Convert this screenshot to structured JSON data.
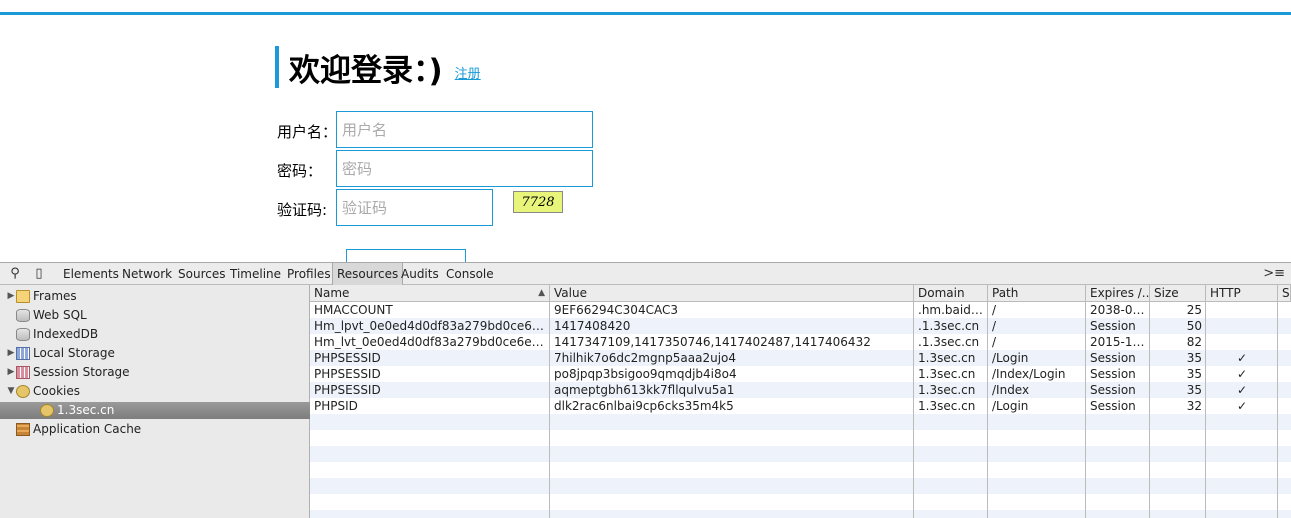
{
  "login": {
    "title": "欢迎登录：)",
    "register_link": "注册",
    "username": {
      "label": "用户名：",
      "placeholder": "用户名",
      "value": ""
    },
    "password": {
      "label": "密码：",
      "placeholder": "密码",
      "value": ""
    },
    "captcha": {
      "label": "验证码:",
      "placeholder": "验证码",
      "value": "",
      "image_text": "7728"
    }
  },
  "colors": {
    "accent": "#1a9ad6",
    "captcha_bg": "#e8f57a"
  },
  "devtools": {
    "icons": {
      "search": "search-icon",
      "device": "device-icon",
      "drawer": "drawer-toggle-icon"
    },
    "tabs": [
      {
        "label": "Elements"
      },
      {
        "label": "Network"
      },
      {
        "label": "Sources"
      },
      {
        "label": "Timeline"
      },
      {
        "label": "Profiles"
      },
      {
        "label": "Resources",
        "active": true
      },
      {
        "label": "Audits"
      },
      {
        "label": "Console"
      }
    ],
    "sidebar": [
      {
        "label": "Frames",
        "icon": "folder-icon",
        "expander": "▶"
      },
      {
        "label": "Web SQL",
        "icon": "database-icon",
        "expander": ""
      },
      {
        "label": "IndexedDB",
        "icon": "database-icon",
        "expander": ""
      },
      {
        "label": "Local Storage",
        "icon": "storage-icon",
        "expander": "▶"
      },
      {
        "label": "Session Storage",
        "icon": "session-storage-icon",
        "expander": "▶"
      },
      {
        "label": "Cookies",
        "icon": "cookie-icon",
        "expander": "▼"
      },
      {
        "label": "1.3sec.cn",
        "icon": "cookie-icon",
        "expander": "",
        "selected": true
      },
      {
        "label": "Application Cache",
        "icon": "application-cache-icon",
        "expander": ""
      }
    ],
    "cookies": {
      "columns": [
        "Name",
        "Value",
        "Domain",
        "Path",
        "Expires /...",
        "Size",
        "HTTP",
        "S"
      ],
      "sort_indicator": "▲",
      "rows": [
        {
          "name": "HMACCOUNT",
          "value": "9EF66294C304CAC3",
          "domain": ".hm.baidu...",
          "path": "/",
          "expires": "2038-01...",
          "size": "25",
          "http": ""
        },
        {
          "name": "Hm_lpvt_0e0ed4d0df83a279bd0ce6e29672...",
          "value": "1417408420",
          "domain": ".1.3sec.cn",
          "path": "/",
          "expires": "Session",
          "size": "50",
          "http": ""
        },
        {
          "name": "Hm_lvt_0e0ed4d0df83a279bd0ce6e296724...",
          "value": "1417347109,1417350746,1417402487,1417406432",
          "domain": ".1.3sec.cn",
          "path": "/",
          "expires": "2015-12...",
          "size": "82",
          "http": ""
        },
        {
          "name": "PHPSESSID",
          "value": "7hilhik7o6dc2mgnp5aaa2ujo4",
          "domain": "1.3sec.cn",
          "path": "/Login",
          "expires": "Session",
          "size": "35",
          "http": "✓"
        },
        {
          "name": "PHPSESSID",
          "value": "po8jpqp3bsigoo9qmqdjb4i8o4",
          "domain": "1.3sec.cn",
          "path": "/Index/Login",
          "expires": "Session",
          "size": "35",
          "http": "✓"
        },
        {
          "name": "PHPSESSID",
          "value": "aqmeptgbh613kk7fllqulvu5a1",
          "domain": "1.3sec.cn",
          "path": "/Index",
          "expires": "Session",
          "size": "35",
          "http": "✓"
        },
        {
          "name": "PHPSID",
          "value": "dlk2rac6nlbai9cp6cks35m4k5",
          "domain": "1.3sec.cn",
          "path": "/Login",
          "expires": "Session",
          "size": "32",
          "http": "✓"
        }
      ]
    }
  }
}
